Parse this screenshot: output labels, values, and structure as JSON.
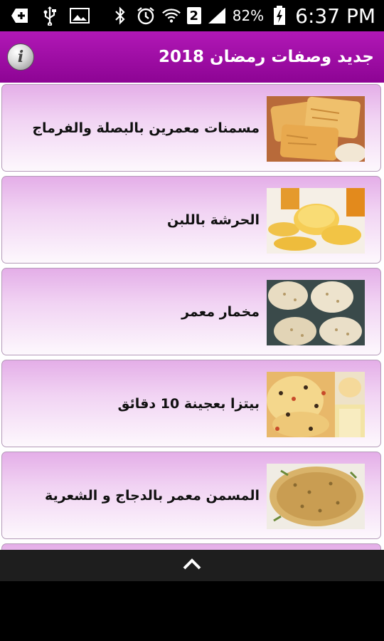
{
  "status_bar": {
    "battery": "82%",
    "time": "6:37 PM",
    "sim_badge": "2",
    "icons": [
      "add-icon",
      "usb-icon",
      "image-icon",
      "bluetooth-icon",
      "alarm-icon",
      "wifi-icon",
      "sim-icon",
      "signal-icon",
      "battery-icon"
    ]
  },
  "app_bar": {
    "title": "جديد وصفات رمضان 2018",
    "info_glyph": "i",
    "colors": {
      "top": "#b118b6",
      "bottom": "#8d0494"
    }
  },
  "recipes": [
    {
      "title": "مسمنات معمرين بالبصلة والفرماج",
      "image": "msemen-stacked-flatbread"
    },
    {
      "title": "الحرشة باللبن",
      "image": "harcha-semolina-bread"
    },
    {
      "title": "مخمار معمر",
      "image": "stuffed-flatbread-plate"
    },
    {
      "title": "بيتزا بعجينة 10 دقائق",
      "image": "pizza-slices"
    },
    {
      "title": "المسمن معمر بالدجاج و الشعرية",
      "image": "chicken-vermicelli-msemen"
    }
  ],
  "bottom_bar": {
    "icon": "chevron-up-icon"
  }
}
